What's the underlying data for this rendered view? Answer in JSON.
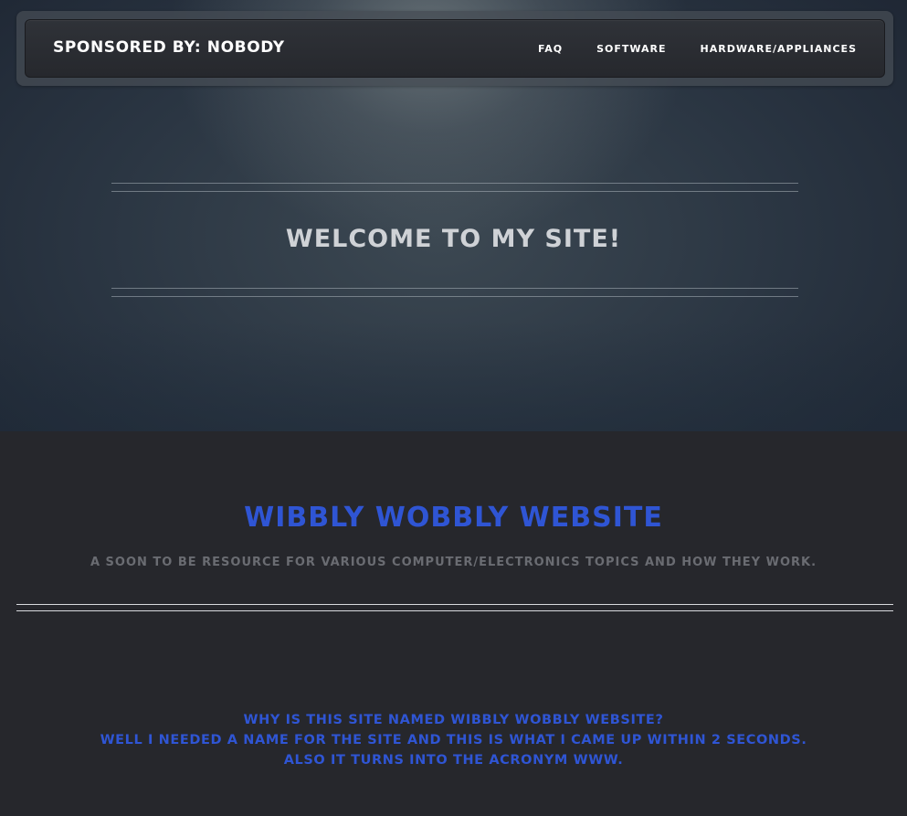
{
  "navbar": {
    "brand": "SPONSORED BY: NOBODY",
    "links": [
      {
        "label": "FAQ"
      },
      {
        "label": "SOFTWARE"
      },
      {
        "label": "HARDWARE/APPLIANCES"
      }
    ]
  },
  "hero": {
    "welcome": "WELCOME TO MY SITE!"
  },
  "intro": {
    "title": "WIBBLY WOBBLY WEBSITE",
    "tagline": "A SOON TO BE RESOURCE FOR VARIOUS COMPUTER/ELECTRONICS TOPICS AND HOW THEY WORK."
  },
  "about": {
    "lines": [
      "WHY IS THIS SITE NAMED WIBBLY WOBBLY WEBSITE?",
      "WELL I NEEDED A NAME FOR THE SITE AND THIS IS WHAT I CAME UP WITHIN 2 SECONDS.",
      "ALSO IT TURNS INTO THE ACRONYM WWW."
    ]
  },
  "colors": {
    "accent_blue": "#2f55d4",
    "page_background": "#26272c",
    "hero_background": "#2a3542",
    "tagline_gray": "#6a6c72"
  }
}
